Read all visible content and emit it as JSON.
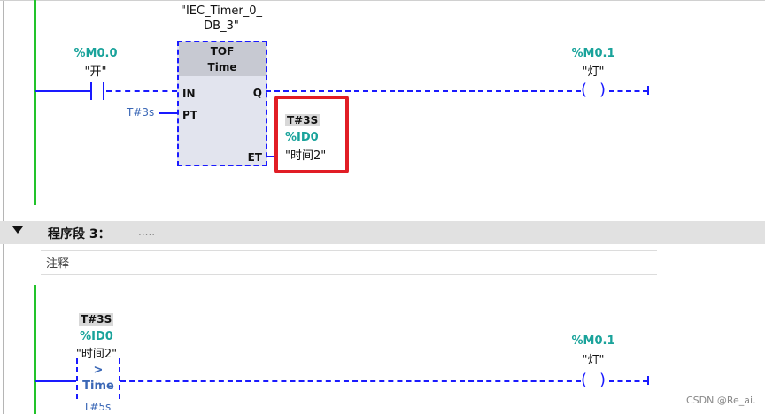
{
  "network2": {
    "instance_name": "\"IEC_Timer_0_",
    "instance_name2": "DB_3\"",
    "contact_address": "%M0.0",
    "contact_symbol": "\"开\"",
    "block_type": "TOF",
    "block_subtype": "Time",
    "pin_in": "IN",
    "pin_pt": "PT",
    "pin_q": "Q",
    "pin_et": "ET",
    "pt_value": "T#3s",
    "et_monitor": "T#3S",
    "et_address": "%ID0",
    "et_symbol": "\"时间2\"",
    "coil_address": "%M0.1",
    "coil_symbol": "\"灯\""
  },
  "network3": {
    "title": "程序段 3：",
    "title_dots": ".....",
    "comment_label": "注释",
    "cmp_monitor": "T#3S",
    "cmp_address": "%ID0",
    "cmp_symbol": "\"时间2\"",
    "cmp_operator": ">",
    "cmp_type": "Time",
    "cmp_value": "T#5s",
    "coil_address": "%M0.1",
    "coil_symbol": "\"灯\""
  },
  "watermark": "CSDN @Re_ai.",
  "colors": {
    "rail": "#22c32b",
    "wire": "#1a1aff",
    "address": "#1aa39b",
    "highlight": "#e11d25",
    "section_bar": "#e1e1e1"
  }
}
